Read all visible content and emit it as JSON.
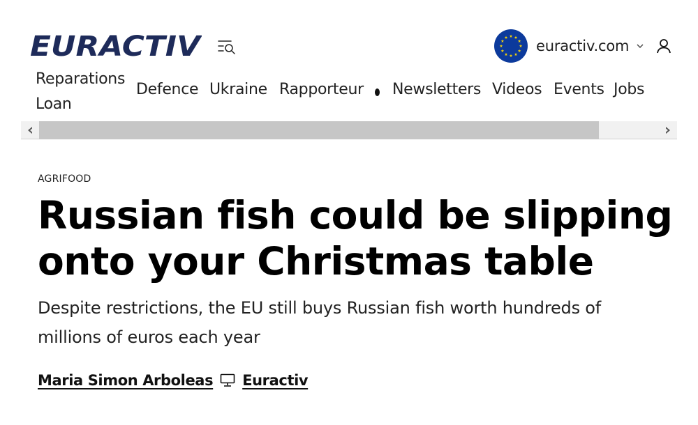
{
  "header": {
    "logo_text": "EURACTIV",
    "edition_label": "euractiv.com",
    "icons": {
      "menu": "menu-search-icon",
      "flag": "eu-flag-icon",
      "chevron": "chevron-down-icon",
      "user": "user-icon"
    }
  },
  "nav": {
    "items": [
      {
        "label": "Reparations Loan"
      },
      {
        "label": "Defence"
      },
      {
        "label": "Ukraine"
      },
      {
        "label": "Rapporteur"
      },
      {
        "label": "Newsletters"
      },
      {
        "label": "Videos"
      },
      {
        "label": "Events"
      },
      {
        "label": "Jobs"
      }
    ]
  },
  "scroll": {
    "left_arrow": "‹",
    "right_arrow": "›"
  },
  "article": {
    "category": "AGRIFOOD",
    "headline": "Russian fish could be slipping onto your Christmas table",
    "subheadline": "Despite restrictions, the EU still buys Russian fish worth hundreds of millions of euros each year",
    "author": "Maria Simon Arboleas",
    "source": "Euractiv"
  },
  "colors": {
    "brand": "#1e2b5a",
    "eu_blue": "#0c3a9c",
    "eu_gold": "#f5d30a",
    "text": "#111111"
  }
}
